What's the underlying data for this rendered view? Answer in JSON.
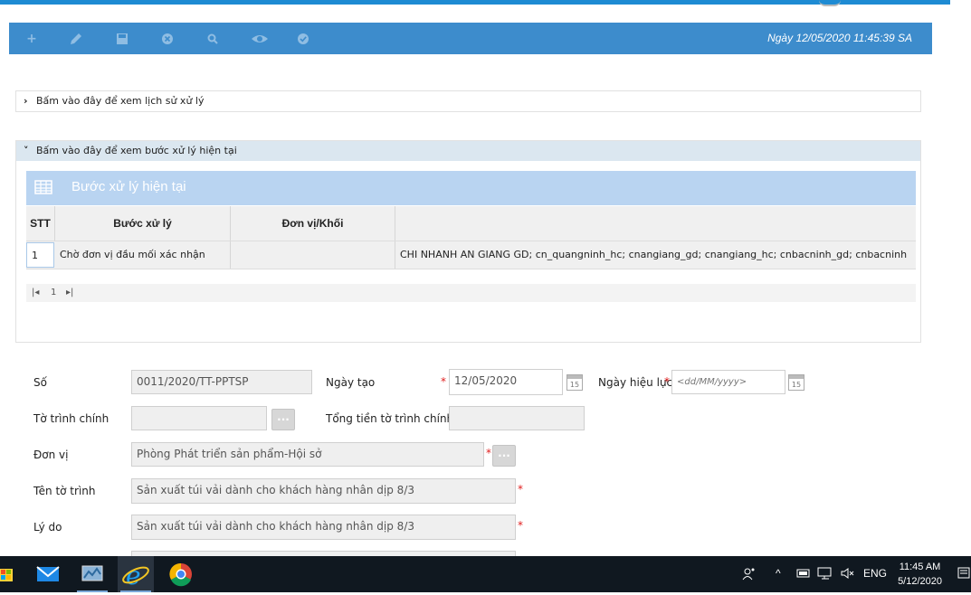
{
  "toolbar": {
    "icons": [
      "plus-icon",
      "pencil-icon",
      "save-icon",
      "cancel-icon",
      "search-icon",
      "eye-icon",
      "check-icon"
    ],
    "date_text": "Ngày 12/05/2020  11:45:39 SA"
  },
  "history_panel": {
    "label": "Bấm vào đây để xem lịch sử xử lý"
  },
  "current_panel": {
    "label": "Bấm vào đây để xem bước xử lý hiện tại",
    "grid_title": "Bước xử lý hiện tại",
    "columns": [
      "STT",
      "Bước xử lý",
      "Đơn vị/Khối",
      ""
    ],
    "rows": [
      {
        "stt": "1",
        "step": "Chờ đơn vị đầu mối xác nhận",
        "unit": "",
        "detail": "CHI NHANH AN GIANG GD; cn_quangninh_hc; cnangiang_gd; cnangiang_hc; cnbacninh_gd; cnbacninh"
      }
    ],
    "pager": {
      "page": "1"
    }
  },
  "form": {
    "so_label": "Số",
    "so_value": "0011/2020/TT-PPTSP",
    "ngay_tao_label": "Ngày tạo",
    "ngay_tao_value": "12/05/2020",
    "ngay_hieu_luc_label": "Ngày hiệu lực",
    "ngay_hieu_luc_placeholder": "<dd/MM/yyyy>",
    "to_trinh_chinh_label": "Tờ trình chính",
    "to_trinh_chinh_value": "",
    "tong_tien_label": "Tổng tiền tờ trình chính",
    "tong_tien_value": "",
    "don_vi_label": "Đơn vị",
    "don_vi_value": "Phòng Phát triển sản phẩm-Hội sở",
    "ten_to_trinh_label": "Tên tờ trình",
    "ten_to_trinh_value": "Sản xuất túi vải dành cho khách hàng nhân dịp 8/3",
    "ly_do_label": "Lý do",
    "ly_do_value": "Sản xuất túi vải dành cho khách hàng nhân dịp 8/3",
    "dots": "...",
    "required_mark": "*",
    "cal_day": "15"
  },
  "taskbar": {
    "tray_lang": "ENG",
    "time": "11:45 AM",
    "date": "5/12/2020"
  },
  "colors": {
    "toolbar_bg": "#3d8ccc",
    "grid_title_bg": "#b9d4f1",
    "required": "#e02020"
  }
}
